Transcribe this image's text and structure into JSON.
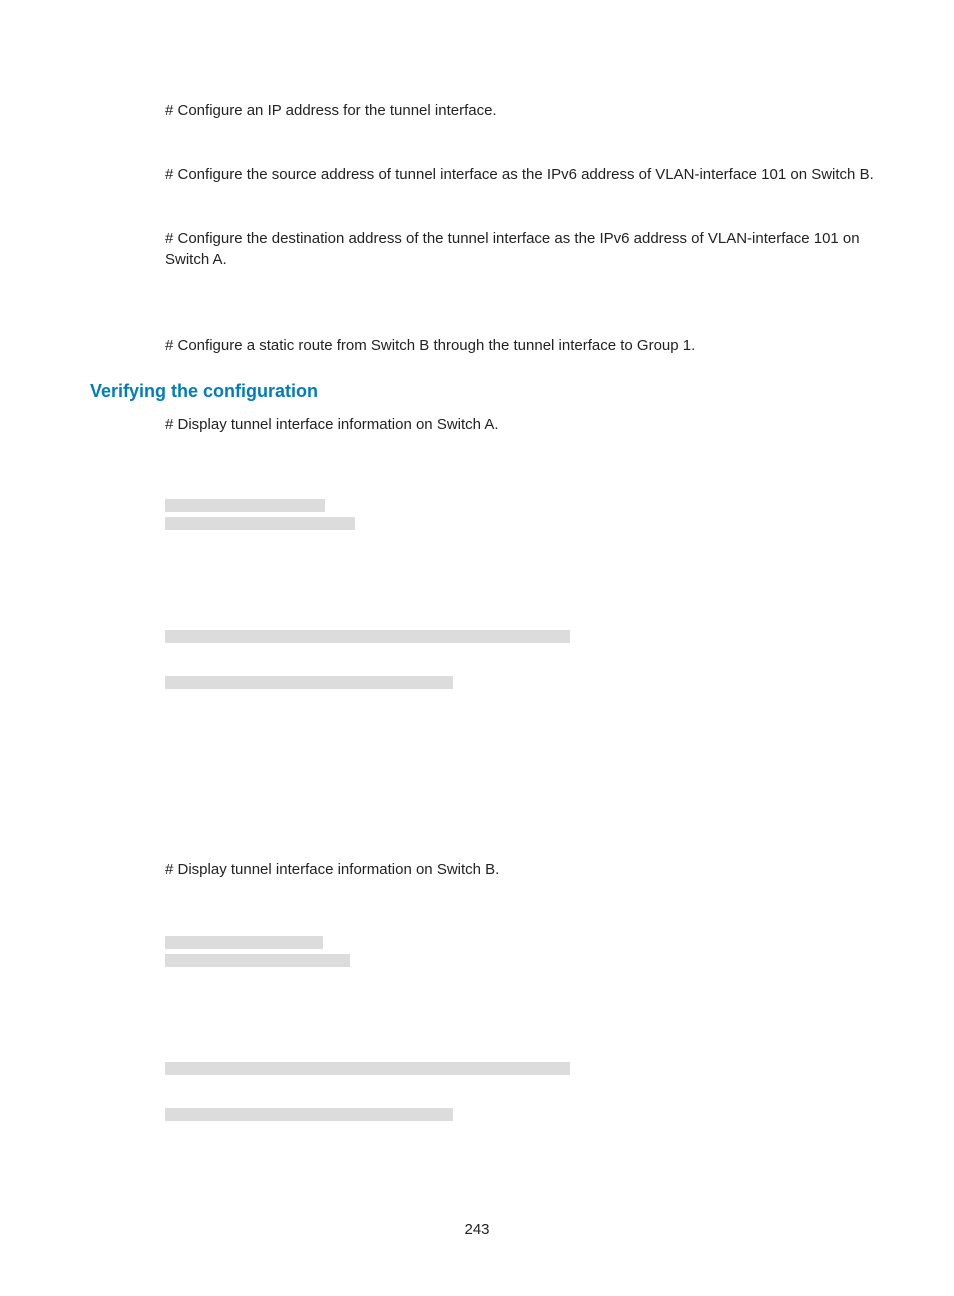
{
  "page": {
    "paragraphs": {
      "p1": "# Configure an IP address for the tunnel interface.",
      "p2": "# Configure the source address of tunnel interface as the IPv6 address of VLAN-interface 101 on Switch B.",
      "p3": "# Configure the destination address of the tunnel interface as the IPv6 address of VLAN-interface 101 on Switch A.",
      "p4": "# Configure a static route from Switch B through the tunnel interface to Group 1.",
      "p5": "# Display tunnel interface information on Switch A.",
      "p6": "# Display tunnel interface information on Switch B."
    },
    "heading": "Verifying the configuration",
    "page_number": "243"
  }
}
